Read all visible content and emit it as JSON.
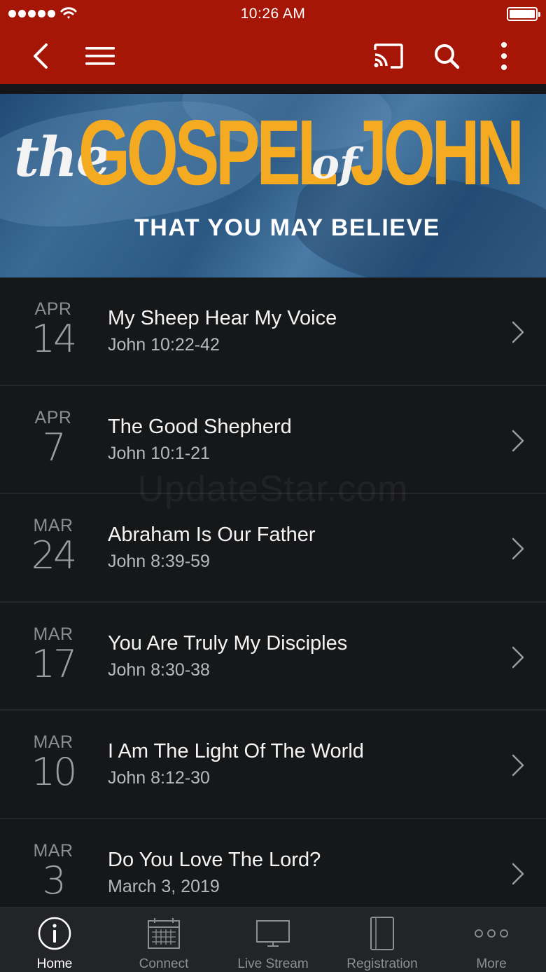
{
  "status_bar": {
    "time": "10:26 AM"
  },
  "nav": {
    "back_icon": "back-chevron-icon",
    "menu_icon": "hamburger-menu-icon",
    "cast_icon": "cast-icon",
    "search_icon": "search-icon",
    "more_icon": "vertical-dots-icon"
  },
  "banner": {
    "word_the": "the",
    "word_gospel": "GOSPEL",
    "word_of": "of",
    "word_john": "JOHN",
    "tagline": "THAT YOU MAY BELIEVE"
  },
  "sermons": [
    {
      "month": "APR",
      "day": "14",
      "title": "My Sheep Hear My Voice",
      "subtitle": "John 10:22-42"
    },
    {
      "month": "APR",
      "day": "7",
      "title": "The Good Shepherd",
      "subtitle": "John 10:1-21"
    },
    {
      "month": "MAR",
      "day": "24",
      "title": "Abraham Is Our Father",
      "subtitle": "John 8:39-59"
    },
    {
      "month": "MAR",
      "day": "17",
      "title": "You Are Truly My Disciples",
      "subtitle": "John 8:30-38"
    },
    {
      "month": "MAR",
      "day": "10",
      "title": "I Am The Light Of The World",
      "subtitle": "John 8:12-30"
    },
    {
      "month": "MAR",
      "day": "3",
      "title": "Do You Love The Lord?",
      "subtitle": "March 3, 2019"
    }
  ],
  "watermark": "UpdateStar.com",
  "tabs": [
    {
      "label": "Home",
      "icon": "info-circle-icon",
      "active": true
    },
    {
      "label": "Connect",
      "icon": "calendar-icon",
      "active": false
    },
    {
      "label": "Live Stream",
      "icon": "monitor-icon",
      "active": false
    },
    {
      "label": "Registration",
      "icon": "tablet-icon",
      "active": false
    },
    {
      "label": "More",
      "icon": "horizontal-dots-icon",
      "active": false
    }
  ],
  "colors": {
    "brand_red": "#a51606",
    "banner_gold": "#f4ab22",
    "list_bg": "#161719",
    "tabbar_bg": "#232427"
  }
}
